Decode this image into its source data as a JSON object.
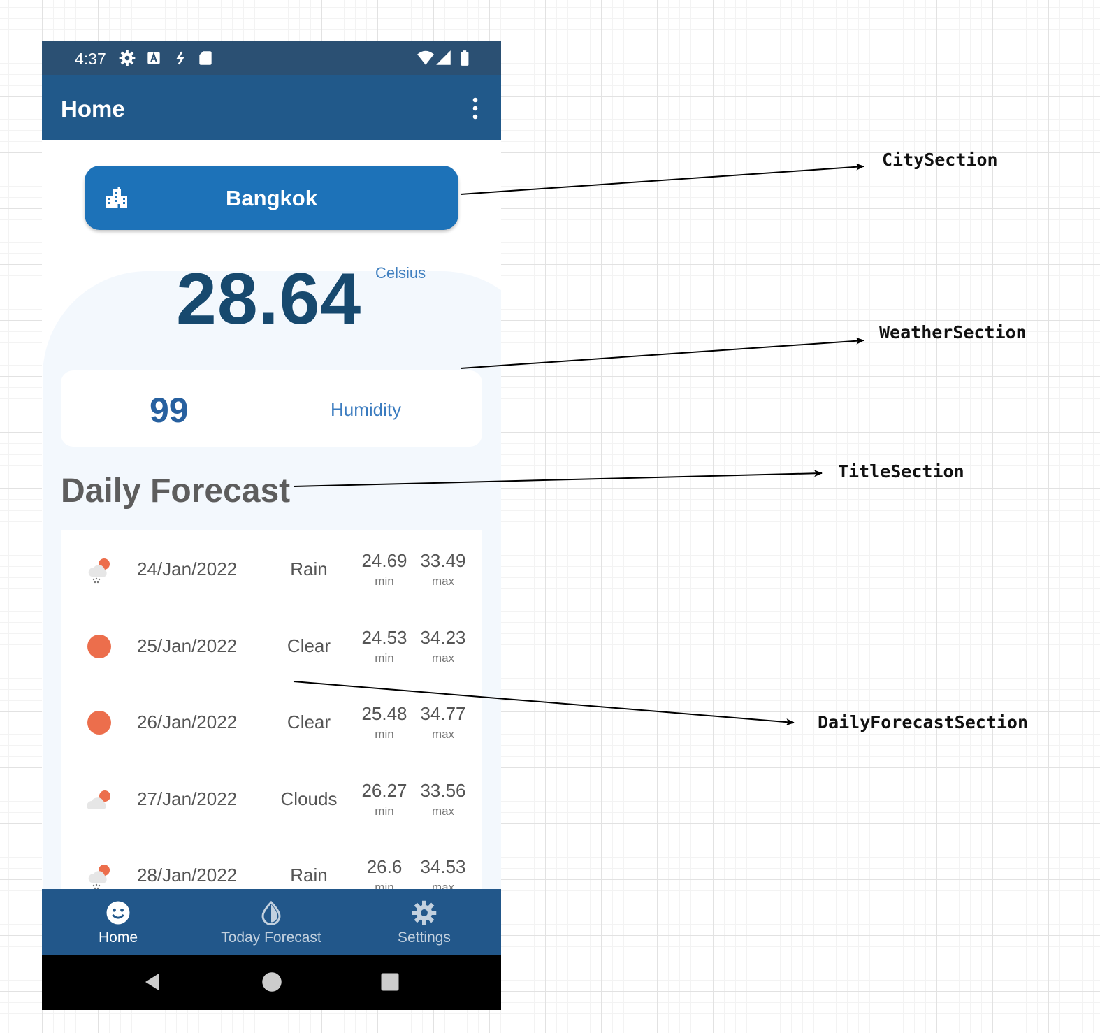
{
  "status_bar": {
    "time": "4:37"
  },
  "app_bar": {
    "title": "Home"
  },
  "city": {
    "name": "Bangkok"
  },
  "weather": {
    "temperature": "28.64",
    "unit": "Celsius",
    "humidity_value": "99",
    "humidity_label": "Humidity"
  },
  "section_title": "Daily Forecast",
  "forecast": [
    {
      "date": "24/Jan/2022",
      "desc": "Rain",
      "min": "24.69",
      "max": "33.49",
      "min_label": "min",
      "max_label": "max",
      "icon": "rain-icon"
    },
    {
      "date": "25/Jan/2022",
      "desc": "Clear",
      "min": "24.53",
      "max": "34.23",
      "min_label": "min",
      "max_label": "max",
      "icon": "sun-icon"
    },
    {
      "date": "26/Jan/2022",
      "desc": "Clear",
      "min": "25.48",
      "max": "34.77",
      "min_label": "min",
      "max_label": "max",
      "icon": "sun-icon"
    },
    {
      "date": "27/Jan/2022",
      "desc": "Clouds",
      "min": "26.27",
      "max": "33.56",
      "min_label": "min",
      "max_label": "max",
      "icon": "clouds-icon"
    },
    {
      "date": "28/Jan/2022",
      "desc": "Rain",
      "min": "26.6",
      "max": "34.53",
      "min_label": "min",
      "max_label": "max",
      "icon": "rain-icon"
    }
  ],
  "bottom_nav": [
    {
      "label": "Home",
      "icon": "smiley-icon",
      "active": true
    },
    {
      "label": "Today Forecast",
      "icon": "drop-icon",
      "active": false
    },
    {
      "label": "Settings",
      "icon": "gear-icon",
      "active": false
    }
  ],
  "annotations": {
    "city": "CitySection",
    "weather": "WeatherSection",
    "title": "TitleSection",
    "daily": "DailyForecastSection"
  },
  "colors": {
    "status_bar": "#2b5073",
    "app_bar": "#21598a",
    "city_button": "#1d72b8",
    "temperature": "#17496e",
    "accent_blue": "#3a7bbf",
    "sun_orange": "#ec6e4c",
    "bottom_nav": "#22578a"
  }
}
